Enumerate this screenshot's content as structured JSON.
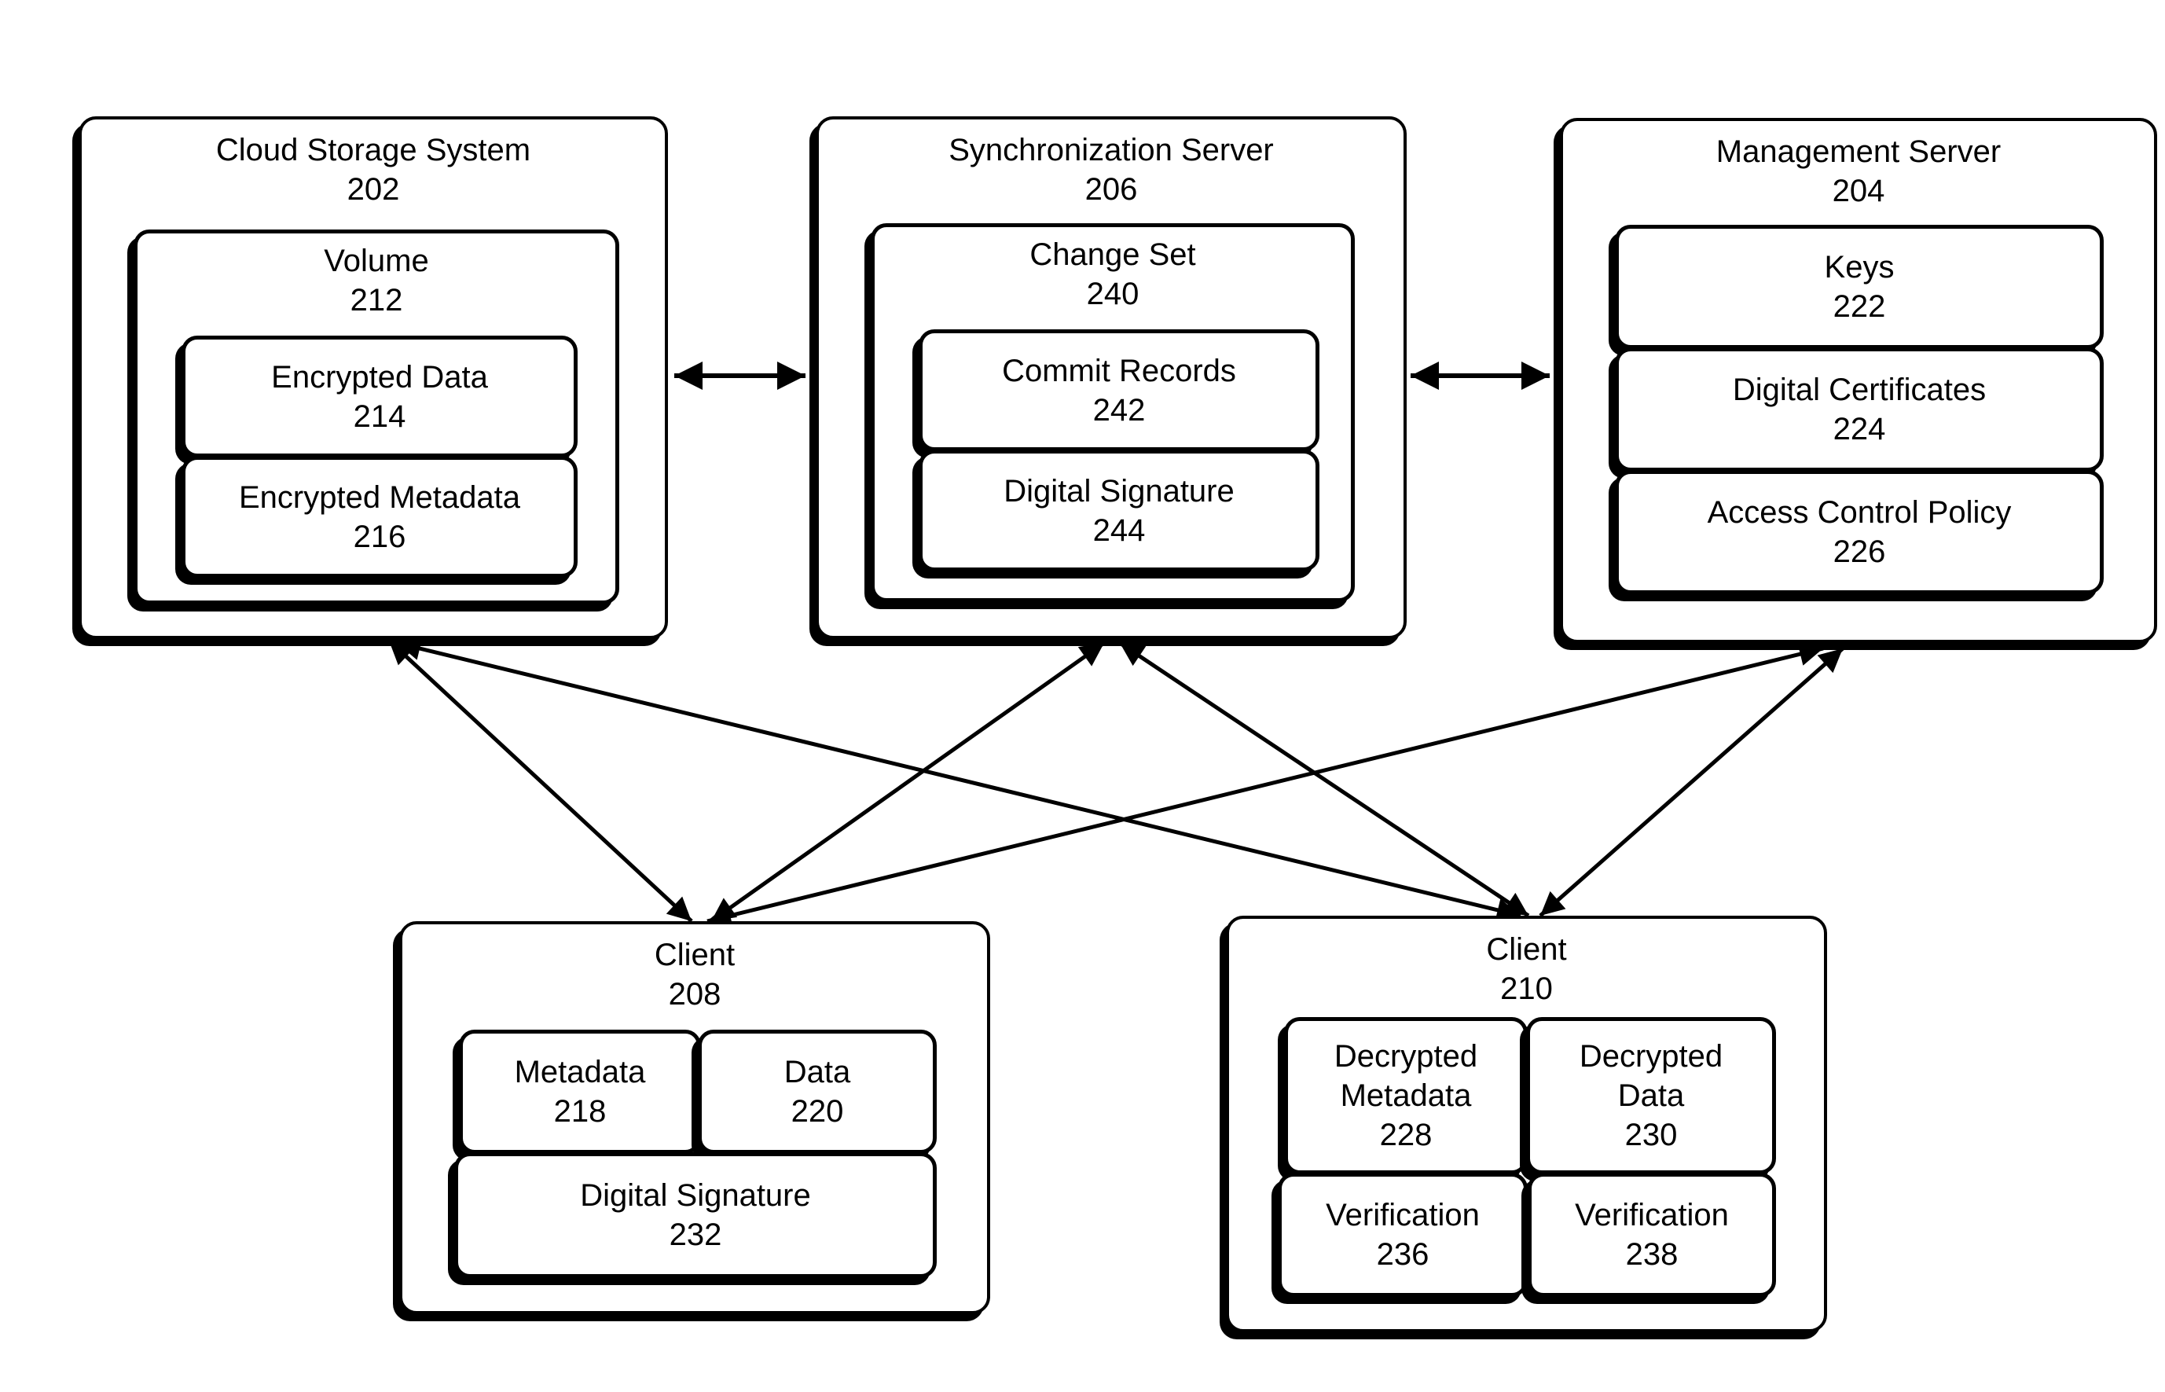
{
  "diagram": {
    "cloud_storage": {
      "title": "Cloud Storage System",
      "ref": "202",
      "volume": {
        "title": "Volume",
        "ref": "212",
        "items": [
          {
            "name": "Encrypted Data",
            "ref": "214"
          },
          {
            "name": "Encrypted Metadata",
            "ref": "216"
          }
        ]
      }
    },
    "sync_server": {
      "title": "Synchronization Server",
      "ref": "206",
      "change_set": {
        "title": "Change Set",
        "ref": "240",
        "items": [
          {
            "name": "Commit Records",
            "ref": "242"
          },
          {
            "name": "Digital Signature",
            "ref": "244"
          }
        ]
      }
    },
    "management_server": {
      "title": "Management Server",
      "ref": "204",
      "items": [
        {
          "name": "Keys",
          "ref": "222"
        },
        {
          "name": "Digital Certificates",
          "ref": "224"
        },
        {
          "name": "Access Control Policy",
          "ref": "226"
        }
      ]
    },
    "client_208": {
      "title": "Client",
      "ref": "208",
      "items": [
        {
          "name": "Metadata",
          "ref": "218"
        },
        {
          "name": "Data",
          "ref": "220"
        },
        {
          "name": "Digital Signature",
          "ref": "232"
        }
      ]
    },
    "client_210": {
      "title": "Client",
      "ref": "210",
      "items": [
        {
          "line1": "Decrypted",
          "line2": "Metadata",
          "ref": "228"
        },
        {
          "line1": "Decrypted",
          "line2": "Data",
          "ref": "230"
        },
        {
          "name": "Verification",
          "ref": "236"
        },
        {
          "name": "Verification",
          "ref": "238"
        }
      ]
    },
    "connections": [
      {
        "from": "Cloud Storage System 202",
        "to": "Synchronization Server 206",
        "type": "bidirectional"
      },
      {
        "from": "Synchronization Server 206",
        "to": "Management Server 204",
        "type": "bidirectional"
      },
      {
        "from": "Cloud Storage System 202",
        "to": "Client 208",
        "type": "bidirectional"
      },
      {
        "from": "Cloud Storage System 202",
        "to": "Client 210",
        "type": "bidirectional"
      },
      {
        "from": "Synchronization Server 206",
        "to": "Client 208",
        "type": "bidirectional"
      },
      {
        "from": "Synchronization Server 206",
        "to": "Client 210",
        "type": "bidirectional"
      },
      {
        "from": "Management Server 204",
        "to": "Client 208",
        "type": "bidirectional"
      },
      {
        "from": "Management Server 204",
        "to": "Client 210",
        "type": "bidirectional"
      }
    ]
  }
}
